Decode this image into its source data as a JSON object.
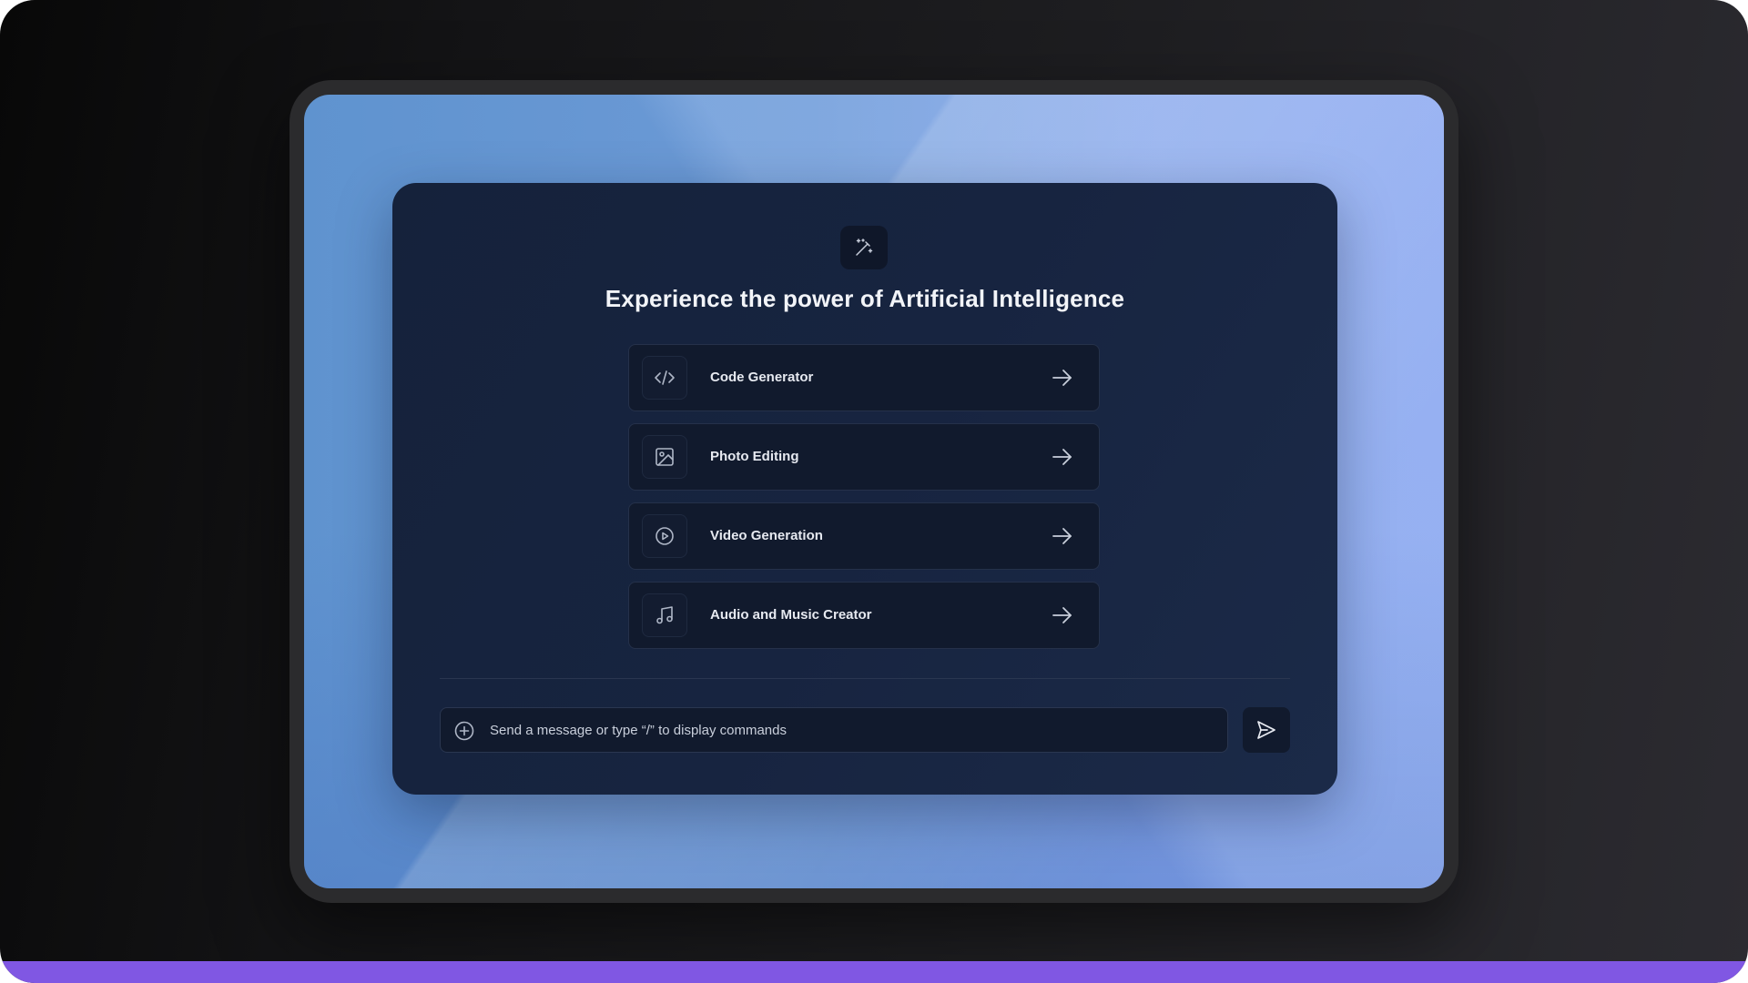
{
  "header": {
    "logo_icon": "magic-wand-icon",
    "title": "Experience the power of Artificial Intelligence"
  },
  "options": [
    {
      "label": "Code Generator",
      "icon": "code-icon"
    },
    {
      "label": "Photo Editing",
      "icon": "image-icon"
    },
    {
      "label": "Video Generation",
      "icon": "play-circle-icon"
    },
    {
      "label": "Audio and Music Creator",
      "icon": "music-note-icon"
    }
  ],
  "composer": {
    "placeholder": "Send a message or type “/” to display commands",
    "value": "",
    "add_icon": "plus-circle-icon",
    "send_icon": "send-icon"
  },
  "colors": {
    "card_bg": "#172440",
    "accent_strip": "#8057e3",
    "text_primary": "#f2f4f8"
  }
}
